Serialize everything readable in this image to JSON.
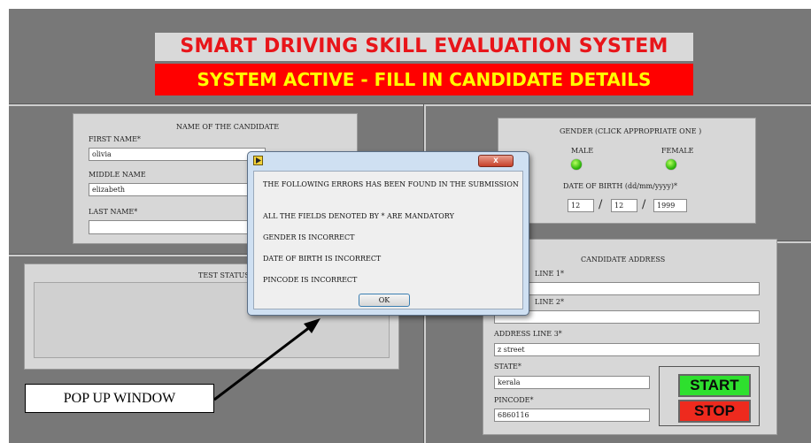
{
  "header": {
    "title": "SMART DRIVING SKILL EVALUATION SYSTEM",
    "status_banner": "SYSTEM ACTIVE - FILL IN CANDIDATE DETAILS"
  },
  "name_section": {
    "heading": "NAME OF THE CANDIDATE",
    "first_name_label": "FIRST NAME*",
    "first_name_value": "olivia",
    "middle_name_label": "MIDDLE NAME",
    "middle_name_value": "elizabeth",
    "last_name_label": "LAST NAME*",
    "last_name_value": ""
  },
  "gender_section": {
    "heading": "GENDER (CLICK APPROPRIATE ONE )",
    "male_label": "MALE",
    "female_label": "FEMALE",
    "dob_label": "DATE OF BIRTH (dd/mm/yyyy)*",
    "dob_day": "12",
    "dob_month": "12",
    "dob_year": "1999",
    "separator": "/"
  },
  "test_status": {
    "heading": "TEST STATUS"
  },
  "address_section": {
    "heading": "CANDIDATE ADDRESS",
    "line1_label": "LINE 1*",
    "line1_value": "",
    "line2_label": "LINE 2*",
    "line2_value": "",
    "line3_label": "ADDRESS LINE 3*",
    "line3_value": "z street",
    "state_label": "STATE*",
    "state_value": "kerala",
    "pincode_label": "PINCODE*",
    "pincode_value": "6860116"
  },
  "buttons": {
    "start": "START",
    "stop": "STOP"
  },
  "dialog": {
    "close_glyph": "x",
    "ok_label": "OK",
    "messages": [
      "THE FOLLOWING ERRORS HAS BEEN FOUND IN THE SUBMISSION",
      "ALL THE FIELDS DENOTED BY * ARE MANDATORY",
      "GENDER IS INCORRECT",
      "DATE OF BIRTH IS INCORRECT",
      "PINCODE IS INCORRECT"
    ]
  },
  "annotation": {
    "callout": "POP UP WINDOW"
  },
  "colors": {
    "panel_bg": "#787878",
    "title_text": "#e8151a",
    "banner_bg": "#ff0000",
    "banner_text": "#ffff00",
    "start_bg": "#2ee02e",
    "stop_bg": "#ee2a1e",
    "led_on": "#31b90d"
  },
  "icons": {
    "dialog_icon": "labview-app-icon",
    "led": "green-led-indicator"
  }
}
